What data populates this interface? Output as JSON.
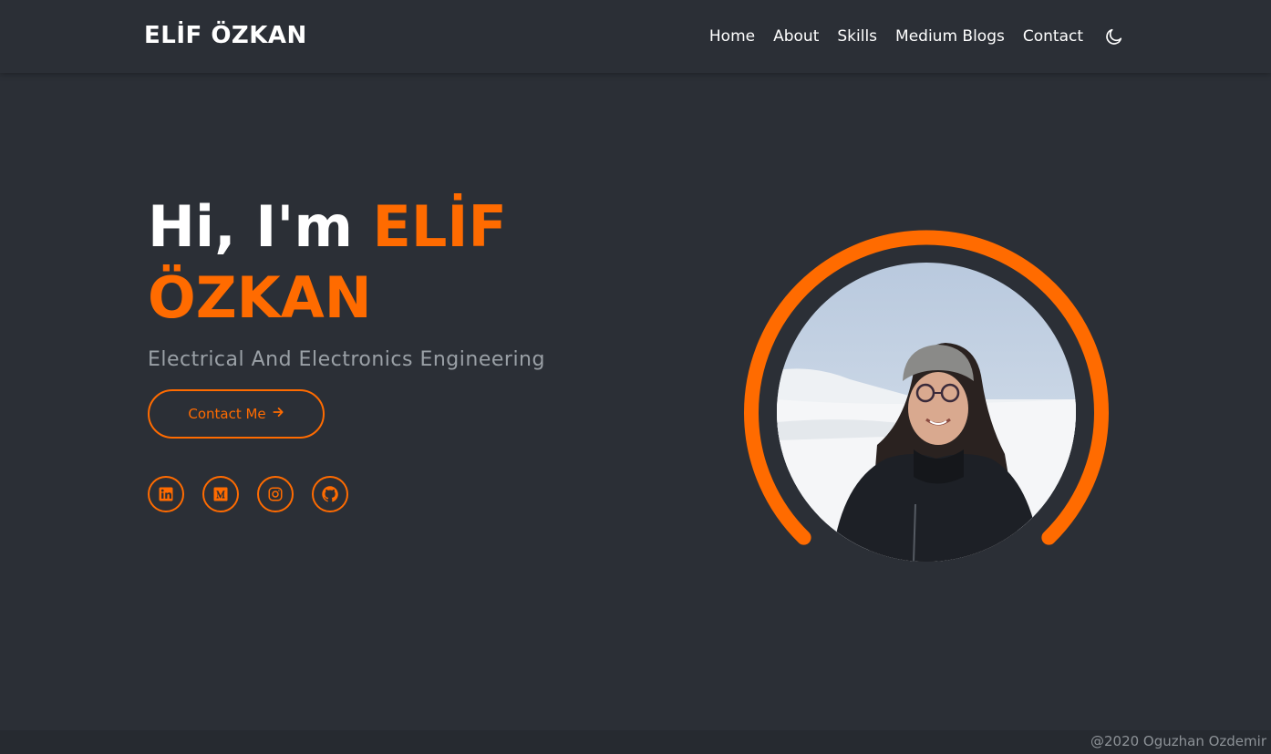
{
  "navbar": {
    "brand": "ELİF ÖZKAN",
    "links": [
      "Home",
      "About",
      "Skills",
      "Medium Blogs",
      "Contact"
    ],
    "theme_icon": "moon-icon"
  },
  "hero": {
    "greeting": "Hi, I'm ",
    "name": "ELİF ÖZKAN",
    "subtitle": "Electrical And Electronics Engineering",
    "contact_button": "Contact Me",
    "contact_icon": "arrow-right-icon",
    "socials": [
      "linkedin-icon",
      "medium-icon",
      "instagram-icon",
      "github-icon"
    ]
  },
  "footer": {
    "text": "@2020 Oguzhan Ozdemir"
  },
  "colors": {
    "accent": "#ff6b00",
    "background": "#2b2f36",
    "subtitle": "#9aa0a6"
  }
}
